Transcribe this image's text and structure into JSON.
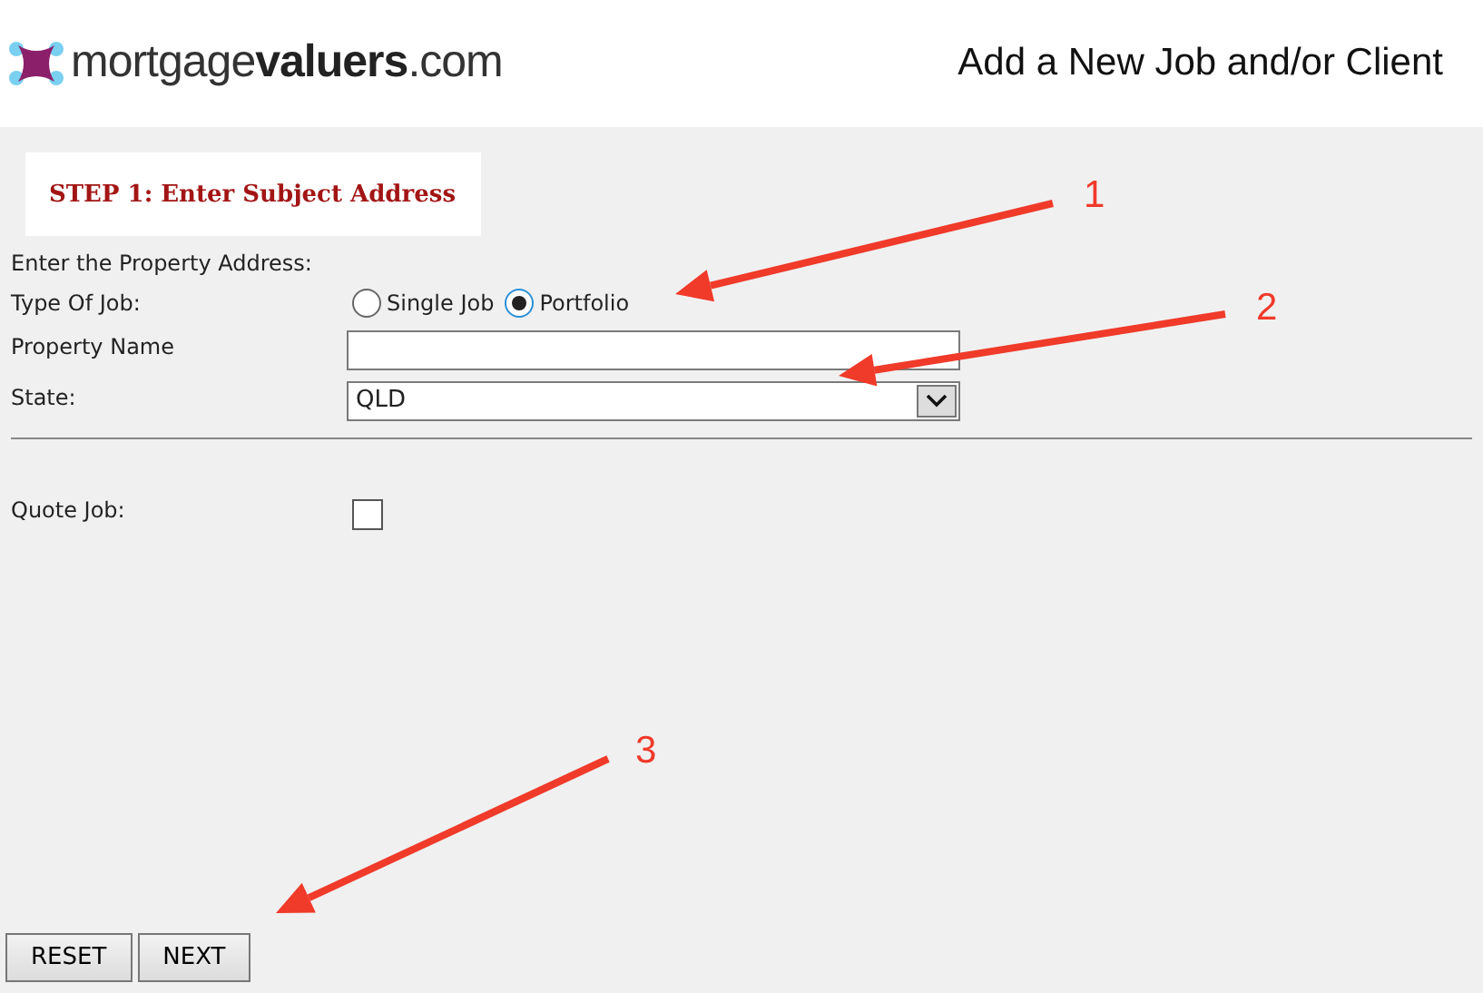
{
  "header": {
    "logo": "mortgage**valuers**.com",
    "title": "Add a New Job and/or Client"
  },
  "tabs": [
    {
      "label": "STEP 1: Enter Subject Address",
      "selected": true
    }
  ],
  "form": {
    "intro": "Enter the Property Address:",
    "job_type": {
      "label": "Type Of Job:",
      "options": [
        {
          "label": "Single Job",
          "selected": false
        },
        {
          "label": "Portfolio",
          "selected": true
        }
      ]
    },
    "property_name": {
      "label": "Property Name"
    },
    "state": {
      "label": "State:",
      "value": "QLD"
    },
    "quote_job": {
      "label": "Quote Job:",
      "checked": false
    }
  },
  "buttons": [
    {
      "label": "RESET"
    },
    {
      "label": "NEXT"
    }
  ],
  "annotations": [
    {
      "label": "1"
    },
    {
      "label": "2"
    },
    {
      "label": "3"
    }
  ]
}
